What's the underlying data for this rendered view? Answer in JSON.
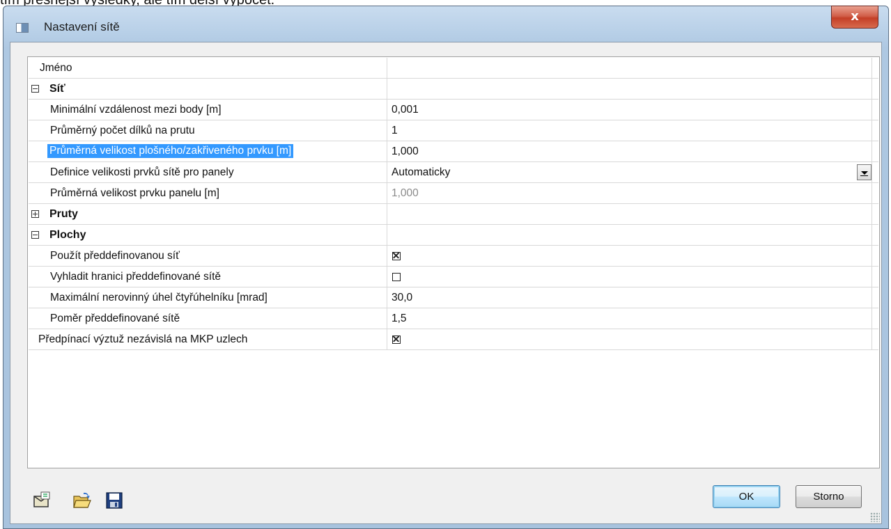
{
  "background_text": "tím přesnější výsledky, ale tím delší výpočet.",
  "window": {
    "title": "Nastavení sítě",
    "close_glyph": "x"
  },
  "grid": {
    "header": {
      "label": "Jméno",
      "value": ""
    },
    "rows": [
      {
        "label": "Síť",
        "group": true,
        "expanded": true
      },
      {
        "label": "Minimální vzdálenost mezi body [m]",
        "value": "0,001"
      },
      {
        "label": "Průměrný počet dílků na prutu",
        "value": "1"
      },
      {
        "label": "Průměrná velikost plošného/zakřiveného prvku [m]",
        "value": "1,000",
        "selected": true
      },
      {
        "label": "Definice velikosti prvků sítě pro panely",
        "value": "Automaticky",
        "dropdown": true
      },
      {
        "label": "Průměrná velikost prvku panelu [m]",
        "value": "1,000",
        "disabled": true
      },
      {
        "label": "Pruty",
        "group": true,
        "expanded": false
      },
      {
        "label": "Plochy",
        "group": true,
        "expanded": true
      },
      {
        "label": "Použít předdefinovanou síť",
        "checked": true
      },
      {
        "label": "Vyhladit hranici předdefinované sítě",
        "checked": false
      },
      {
        "label": "Maximální nerovinný úhel čtyřúhelníku [mrad]",
        "value": "30,0"
      },
      {
        "label": "Poměr předdefinované sítě",
        "value": "1,5"
      },
      {
        "label": "Předpínací výztuž nezávislá na MKP uzlech",
        "checked": true
      }
    ]
  },
  "toolbar": {
    "icons": [
      "default-settings-icon",
      "open-folder-icon",
      "save-disk-icon"
    ]
  },
  "buttons": {
    "ok": "OK",
    "cancel": "Storno"
  },
  "colors": {
    "selection": "#3399ff",
    "close_button": "#c94a33",
    "title_gradient_top": "#c9dcef"
  }
}
